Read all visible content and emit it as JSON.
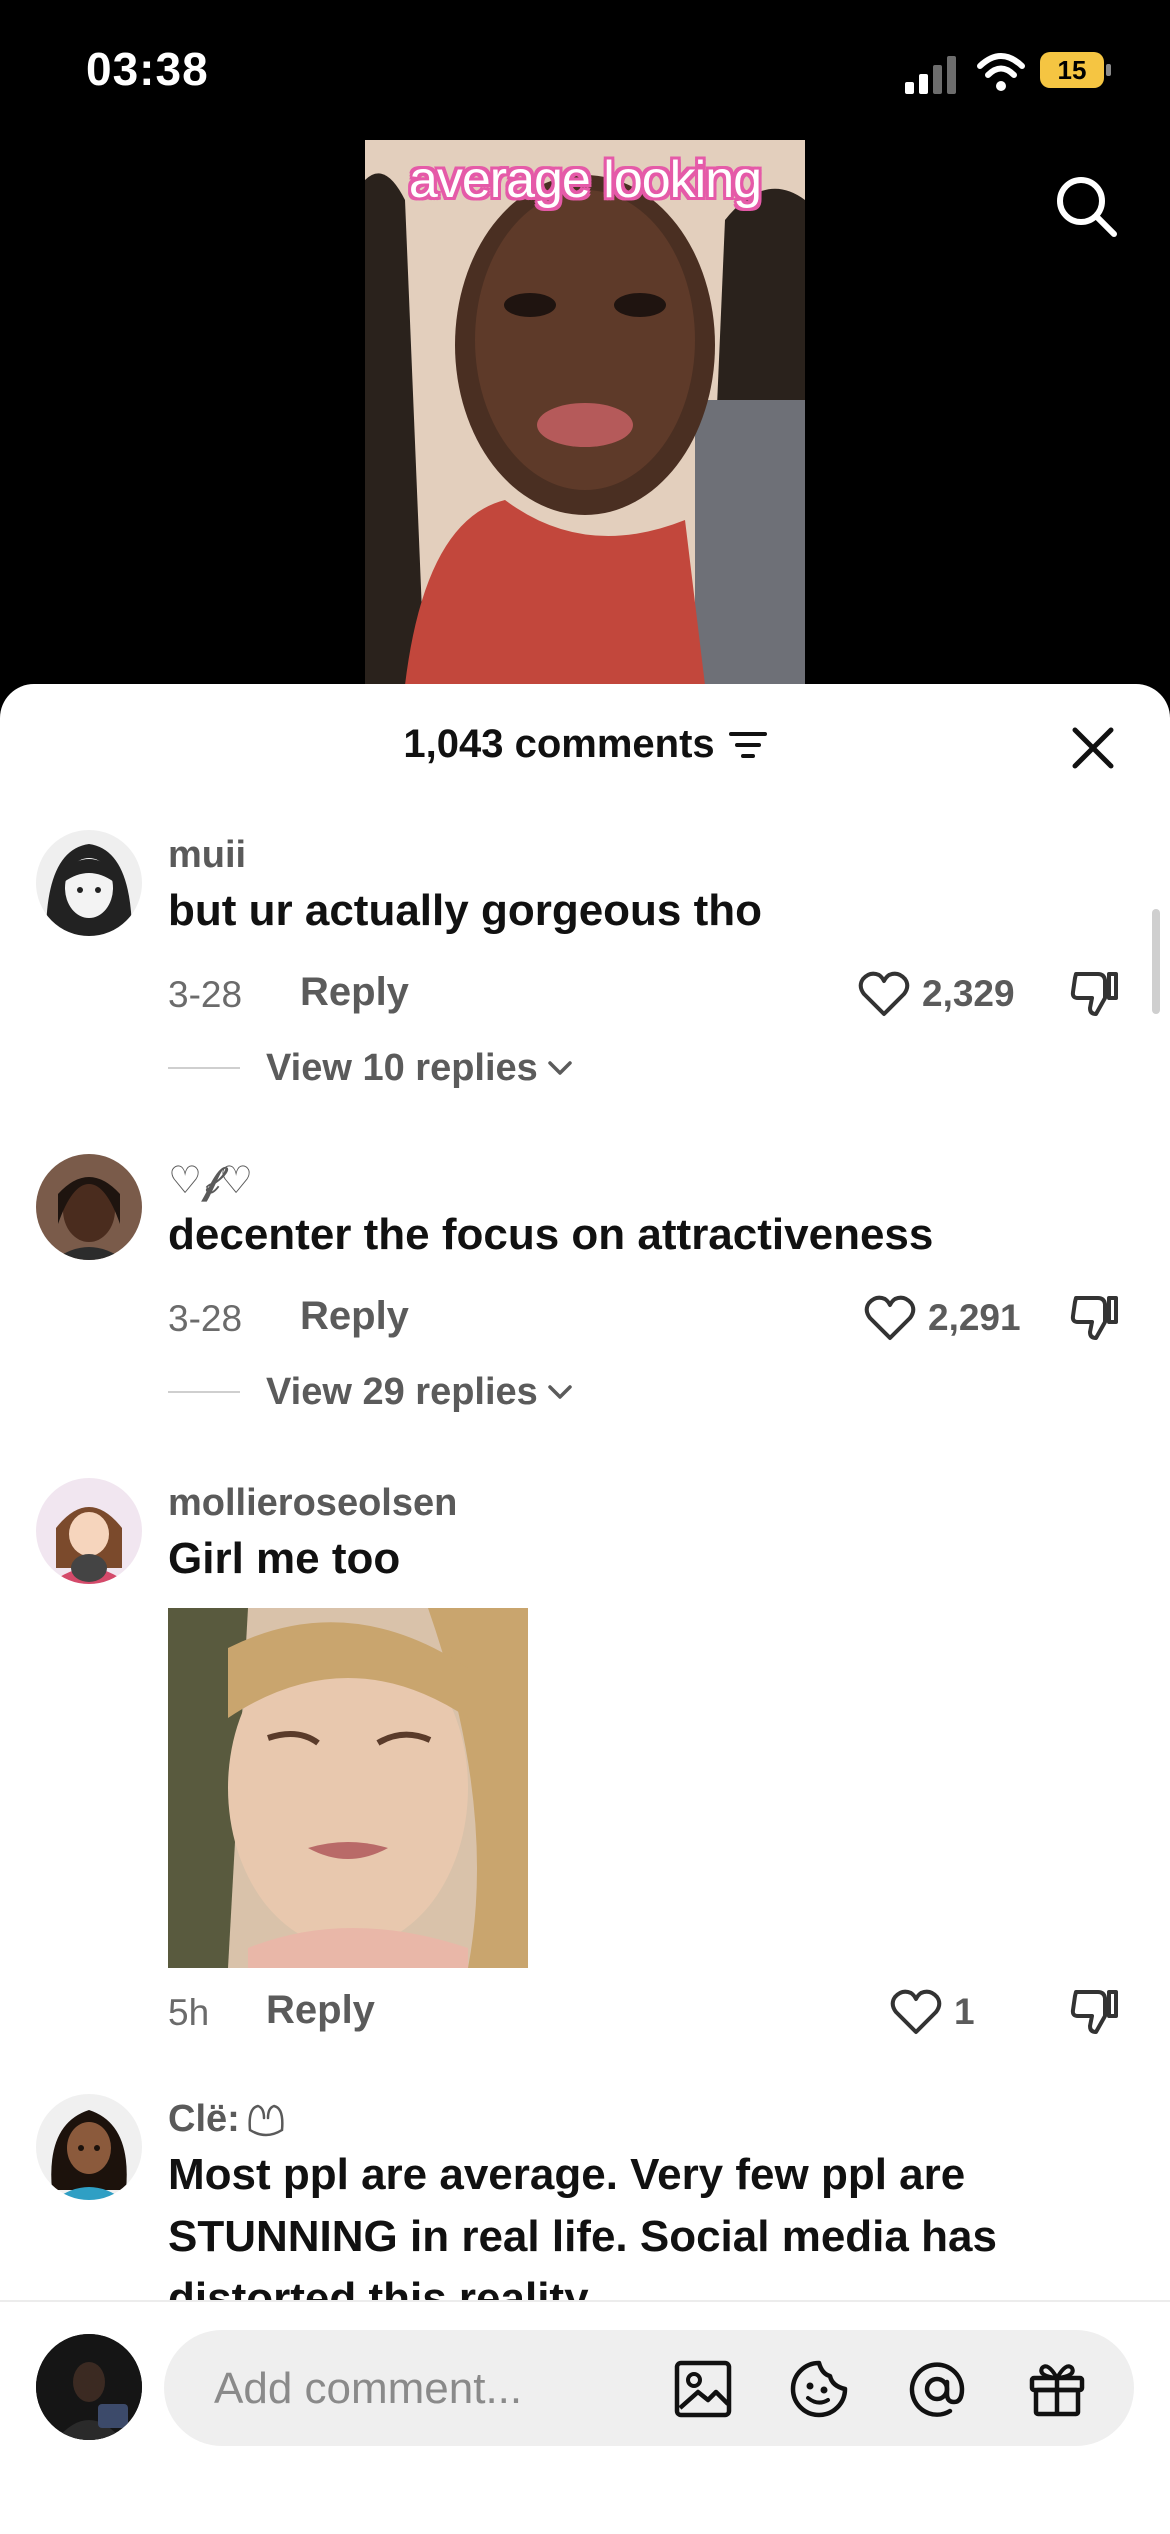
{
  "status_bar": {
    "time": "03:38",
    "battery": "15"
  },
  "video": {
    "caption": "average looking"
  },
  "comments_sheet": {
    "title": "1,043 comments",
    "comments": [
      {
        "username": "muii",
        "text": "but ur actually gorgeous tho",
        "date": "3-28",
        "reply_label": "Reply",
        "likes": "2,329",
        "view_replies": "View 10 replies"
      },
      {
        "username": "♡𝒻♡",
        "text": "decenter the focus on attractiveness",
        "date": "3-28",
        "reply_label": "Reply",
        "likes": "2,291",
        "view_replies": "View 29 replies"
      },
      {
        "username": "mollieroseolsen",
        "text": "Girl me too",
        "date": "5h",
        "reply_label": "Reply",
        "likes": "1"
      },
      {
        "username": "Clë:",
        "text": "Most ppl are average. Very few ppl are STUNNING in real life. Social media has distorted this reality"
      }
    ]
  },
  "composer": {
    "placeholder": "Add comment..."
  },
  "icons": {
    "search": "search-icon",
    "close": "close-icon",
    "sort": "sort-filter-icon",
    "like": "heart-icon",
    "dislike": "thumbs-down-icon",
    "image": "image-icon",
    "sticker": "emoji-sticker-icon",
    "mention": "at-mention-icon",
    "gift": "gift-icon"
  }
}
